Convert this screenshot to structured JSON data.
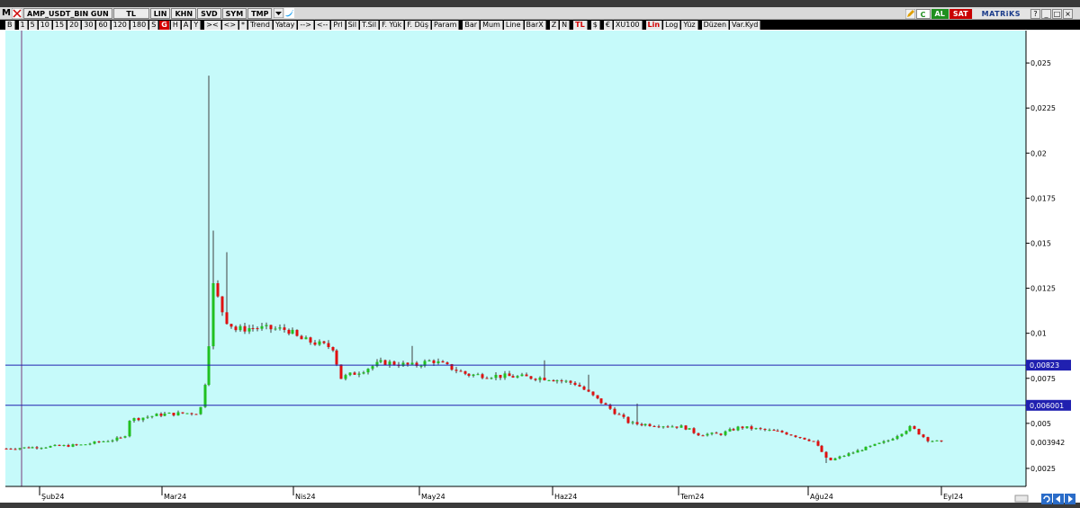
{
  "window": {
    "symbol": "AMP_USDT_BIN GUN",
    "currency": "TL",
    "buttons": [
      "LIN",
      "KHN",
      "SVD",
      "SYM",
      "TMP"
    ],
    "right_buttons": {
      "c": "C",
      "al": "AL",
      "sat": "SAT",
      "brand": "MATRiKS"
    }
  },
  "toolbar": {
    "items": [
      "B",
      "1",
      "5",
      "10",
      "15",
      "20",
      "30",
      "60",
      "120",
      "180",
      "S",
      "G",
      "H",
      "A",
      "Y",
      "><",
      "<>",
      "*",
      "Trend",
      "Yatay",
      "-->",
      "<--",
      "Prl",
      "Sil",
      "T.Sil",
      "F. Yük",
      "F. Düş",
      "Param",
      "Bar",
      "Mum",
      "Line",
      "BarX",
      "Z",
      "N",
      "TL",
      "$",
      "€",
      "XU100",
      "Lin",
      "Log",
      "Yüz",
      "Düzen",
      "Var.Kyd"
    ]
  },
  "colors": {
    "plot_bg": "#c6fafa",
    "up": "#20c020",
    "down": "#e01010",
    "hline": "#2020b0",
    "accent_red": "#d40000"
  },
  "chart_data": {
    "type": "candlestick",
    "title": "",
    "xlabel": "",
    "ylabel": "",
    "ylim": [
      0.0015,
      0.0268
    ],
    "grid": false,
    "x_ticks": [
      "Şub24",
      "Mar24",
      "Nis24",
      "May24",
      "Haz24",
      "Tem24",
      "Ağu24",
      "Eyl24"
    ],
    "y_ticks": [
      "0,0025",
      "0,005",
      "0,0075",
      "0,01",
      "0,0125",
      "0,015",
      "0,0175",
      "0,02",
      "0,0225",
      "0,025"
    ],
    "horizontal_lines": [
      {
        "value": 0.00823,
        "label": "0,00823"
      },
      {
        "value": 0.006001,
        "label": "0,006001"
      }
    ],
    "last_value_label": "0,003942",
    "key_prices": {
      "start": 0.0036,
      "pre_spike": 0.0056,
      "spike_high": 0.0243,
      "spike_close": 0.0128,
      "march_end": 0.0097,
      "april_mid": 0.0075,
      "may_high": 0.0093,
      "june_start": 0.0072,
      "july": 0.0044,
      "august_low": 0.0029,
      "last": 0.003942
    }
  }
}
